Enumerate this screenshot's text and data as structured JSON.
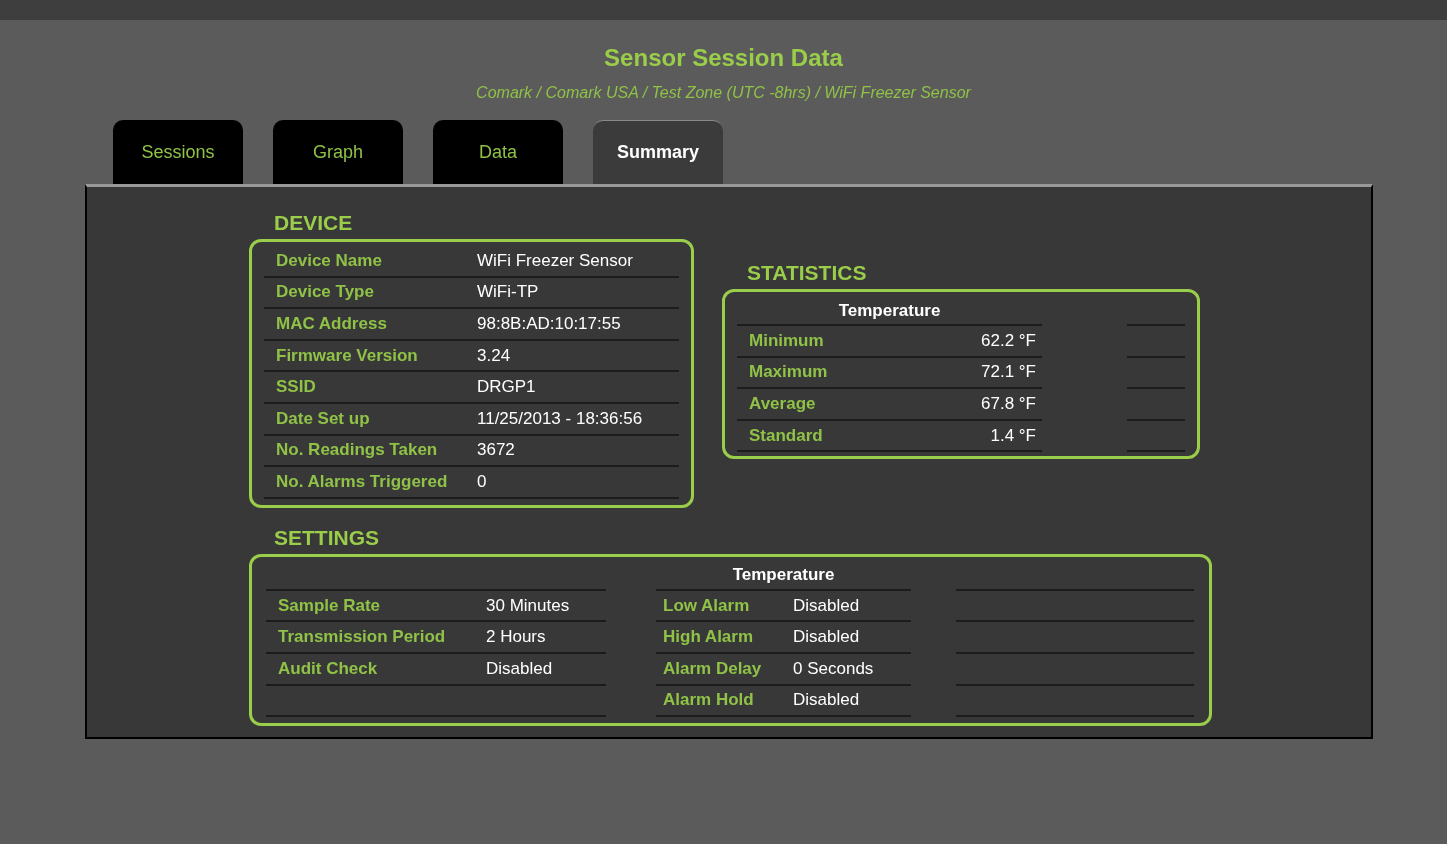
{
  "title": "Sensor Session Data",
  "breadcrumb": "Comark  / Comark USA  / Test Zone  (UTC -8hrs) / WiFi Freezer Sensor",
  "tabs": [
    {
      "label": "Sessions",
      "selected": false
    },
    {
      "label": "Graph",
      "selected": false
    },
    {
      "label": "Data",
      "selected": false
    },
    {
      "label": "Summary",
      "selected": true
    }
  ],
  "device": {
    "heading": "DEVICE",
    "rows": [
      {
        "label": "Device Name",
        "value": "WiFi Freezer Sensor"
      },
      {
        "label": "Device Type",
        "value": "WiFi-TP"
      },
      {
        "label": "MAC Address",
        "value": "98:8B:AD:10:17:55"
      },
      {
        "label": "Firmware Version",
        "value": "3.24"
      },
      {
        "label": "SSID",
        "value": "DRGP1"
      },
      {
        "label": "Date Set up",
        "value": "11/25/2013 - 18:36:56"
      },
      {
        "label": "No. Readings Taken",
        "value": "3672"
      },
      {
        "label": "No. Alarms Triggered",
        "value": "0"
      }
    ]
  },
  "statistics": {
    "heading": "STATISTICS",
    "column_header": "Temperature",
    "rows": [
      {
        "label": "Minimum",
        "value": "62.2 °F"
      },
      {
        "label": "Maximum",
        "value": "72.1 °F"
      },
      {
        "label": "Average",
        "value": "67.8 °F"
      },
      {
        "label": "Standard",
        "value": "1.4 °F"
      }
    ]
  },
  "settings": {
    "heading": "SETTINGS",
    "column_header": "Temperature",
    "general_rows": [
      {
        "label": "Sample Rate",
        "value": "30 Minutes"
      },
      {
        "label": "Transmission Period",
        "value": "2 Hours"
      },
      {
        "label": "Audit Check",
        "value": "Disabled"
      }
    ],
    "temperature_rows": [
      {
        "label": "Low Alarm",
        "value": "Disabled"
      },
      {
        "label": "High Alarm",
        "value": "Disabled"
      },
      {
        "label": "Alarm Delay",
        "value": "0 Seconds"
      },
      {
        "label": "Alarm Hold",
        "value": "Disabled"
      }
    ]
  }
}
